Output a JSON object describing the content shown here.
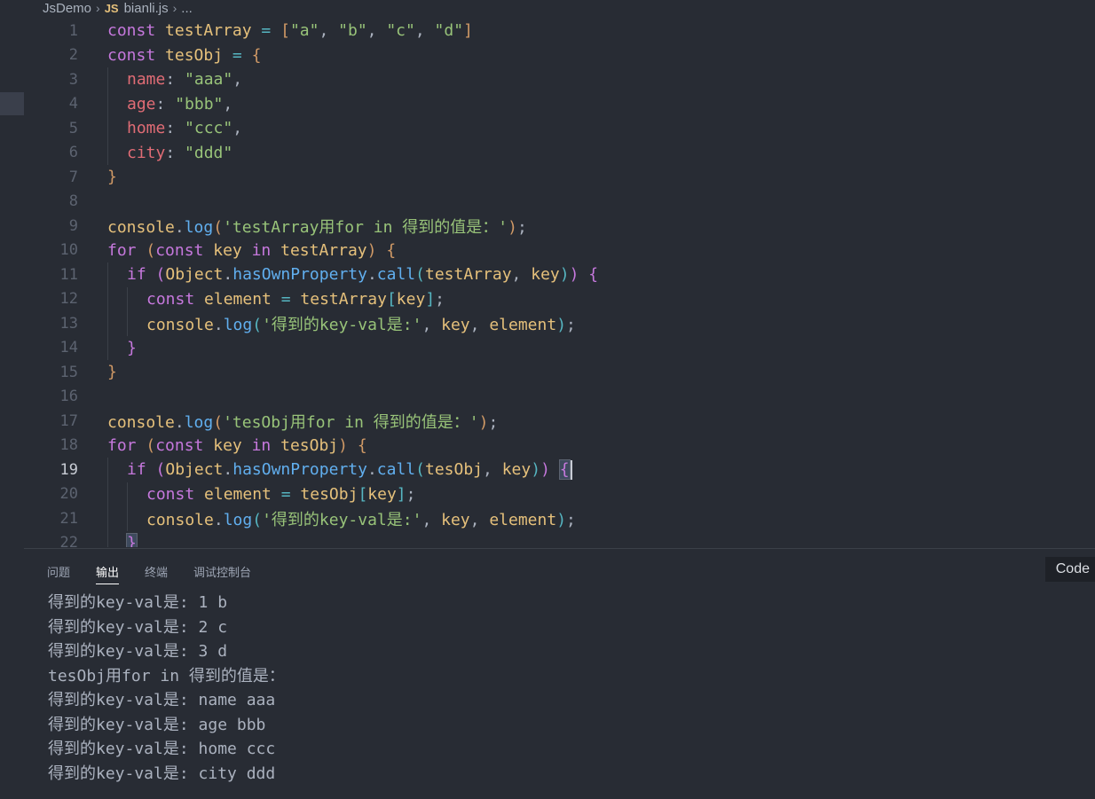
{
  "breadcrumb": {
    "folder": "JsDemo",
    "file_badge": "JS",
    "file": "bianli.js",
    "more": "..."
  },
  "editor": {
    "active_line": 19,
    "lines": [
      {
        "n": "1",
        "indent": 0,
        "tokens": [
          [
            "kw",
            "const "
          ],
          [
            "var",
            "testArray"
          ],
          [
            "op",
            " = "
          ],
          [
            "b1",
            "["
          ],
          [
            "str",
            "\"a\""
          ],
          [
            "pun",
            ", "
          ],
          [
            "str",
            "\"b\""
          ],
          [
            "pun",
            ", "
          ],
          [
            "str",
            "\"c\""
          ],
          [
            "pun",
            ", "
          ],
          [
            "str",
            "\"d\""
          ],
          [
            "b1",
            "]"
          ]
        ]
      },
      {
        "n": "2",
        "indent": 0,
        "tokens": [
          [
            "kw",
            "const "
          ],
          [
            "var",
            "tesObj"
          ],
          [
            "op",
            " = "
          ],
          [
            "b1",
            "{"
          ]
        ]
      },
      {
        "n": "3",
        "indent": 1,
        "tokens": [
          [
            "prop",
            "name"
          ],
          [
            "pun",
            ": "
          ],
          [
            "str",
            "\"aaa\""
          ],
          [
            "pun",
            ","
          ]
        ]
      },
      {
        "n": "4",
        "indent": 1,
        "tokens": [
          [
            "prop",
            "age"
          ],
          [
            "pun",
            ": "
          ],
          [
            "str",
            "\"bbb\""
          ],
          [
            "pun",
            ","
          ]
        ]
      },
      {
        "n": "5",
        "indent": 1,
        "tokens": [
          [
            "prop",
            "home"
          ],
          [
            "pun",
            ": "
          ],
          [
            "str",
            "\"ccc\""
          ],
          [
            "pun",
            ","
          ]
        ]
      },
      {
        "n": "6",
        "indent": 1,
        "tokens": [
          [
            "prop",
            "city"
          ],
          [
            "pun",
            ": "
          ],
          [
            "str",
            "\"ddd\""
          ]
        ]
      },
      {
        "n": "7",
        "indent": 0,
        "tokens": [
          [
            "b1",
            "}"
          ]
        ]
      },
      {
        "n": "8",
        "indent": 0,
        "tokens": []
      },
      {
        "n": "9",
        "indent": 0,
        "tokens": [
          [
            "var",
            "console"
          ],
          [
            "pun",
            "."
          ],
          [
            "fn",
            "log"
          ],
          [
            "b1",
            "("
          ],
          [
            "str",
            "'testArray用for in 得到的值是："
          ],
          [
            "str",
            "'"
          ],
          [
            "b1",
            ")"
          ],
          [
            "pun",
            ";"
          ]
        ]
      },
      {
        "n": "10",
        "indent": 0,
        "tokens": [
          [
            "kw",
            "for "
          ],
          [
            "b1",
            "("
          ],
          [
            "kw",
            "const "
          ],
          [
            "var",
            "key "
          ],
          [
            "kw",
            "in "
          ],
          [
            "var",
            "testArray"
          ],
          [
            "b1",
            ")"
          ],
          [
            "pun",
            " "
          ],
          [
            "b1",
            "{"
          ]
        ]
      },
      {
        "n": "11",
        "indent": 1,
        "tokens": [
          [
            "kw",
            "if "
          ],
          [
            "b2",
            "("
          ],
          [
            "var",
            "Object"
          ],
          [
            "pun",
            "."
          ],
          [
            "fn",
            "hasOwnProperty"
          ],
          [
            "pun",
            "."
          ],
          [
            "fn",
            "call"
          ],
          [
            "b3",
            "("
          ],
          [
            "var",
            "testArray"
          ],
          [
            "pun",
            ", "
          ],
          [
            "var",
            "key"
          ],
          [
            "b3",
            ")"
          ],
          [
            "b2",
            ")"
          ],
          [
            "pun",
            " "
          ],
          [
            "b2",
            "{"
          ]
        ]
      },
      {
        "n": "12",
        "indent": 2,
        "tokens": [
          [
            "kw",
            "const "
          ],
          [
            "var",
            "element"
          ],
          [
            "op",
            " = "
          ],
          [
            "var",
            "testArray"
          ],
          [
            "b3",
            "["
          ],
          [
            "var",
            "key"
          ],
          [
            "b3",
            "]"
          ],
          [
            "pun",
            ";"
          ]
        ]
      },
      {
        "n": "13",
        "indent": 2,
        "tokens": [
          [
            "var",
            "console"
          ],
          [
            "pun",
            "."
          ],
          [
            "fn",
            "log"
          ],
          [
            "b3",
            "("
          ],
          [
            "str",
            "'得到的key-val是:'"
          ],
          [
            "pun",
            ", "
          ],
          [
            "var",
            "key"
          ],
          [
            "pun",
            ", "
          ],
          [
            "var",
            "element"
          ],
          [
            "b3",
            ")"
          ],
          [
            "pun",
            ";"
          ]
        ]
      },
      {
        "n": "14",
        "indent": 1,
        "tokens": [
          [
            "b2",
            "}"
          ]
        ]
      },
      {
        "n": "15",
        "indent": 0,
        "tokens": [
          [
            "b1",
            "}"
          ]
        ]
      },
      {
        "n": "16",
        "indent": 0,
        "tokens": []
      },
      {
        "n": "17",
        "indent": 0,
        "tokens": [
          [
            "var",
            "console"
          ],
          [
            "pun",
            "."
          ],
          [
            "fn",
            "log"
          ],
          [
            "b1",
            "("
          ],
          [
            "str",
            "'tesObj用for in 得到的值是："
          ],
          [
            "str",
            "'"
          ],
          [
            "b1",
            ")"
          ],
          [
            "pun",
            ";"
          ]
        ]
      },
      {
        "n": "18",
        "indent": 0,
        "tokens": [
          [
            "kw",
            "for "
          ],
          [
            "b1",
            "("
          ],
          [
            "kw",
            "const "
          ],
          [
            "var",
            "key "
          ],
          [
            "kw",
            "in "
          ],
          [
            "var",
            "tesObj"
          ],
          [
            "b1",
            ")"
          ],
          [
            "pun",
            " "
          ],
          [
            "b1",
            "{"
          ]
        ]
      },
      {
        "n": "19",
        "indent": 1,
        "tokens": [
          [
            "kw",
            "if "
          ],
          [
            "b2",
            "("
          ],
          [
            "var",
            "Object"
          ],
          [
            "pun",
            "."
          ],
          [
            "fn",
            "hasOwnProperty"
          ],
          [
            "pun",
            "."
          ],
          [
            "fn",
            "call"
          ],
          [
            "b3",
            "("
          ],
          [
            "var",
            "tesObj"
          ],
          [
            "pun",
            ", "
          ],
          [
            "var",
            "key"
          ],
          [
            "b3",
            ")"
          ],
          [
            "b2",
            ")"
          ],
          [
            "pun",
            " "
          ],
          [
            "b2 bm",
            "{"
          ]
        ]
      },
      {
        "n": "20",
        "indent": 2,
        "tokens": [
          [
            "kw",
            "const "
          ],
          [
            "var",
            "element"
          ],
          [
            "op",
            " = "
          ],
          [
            "var",
            "tesObj"
          ],
          [
            "b3",
            "["
          ],
          [
            "var",
            "key"
          ],
          [
            "b3",
            "]"
          ],
          [
            "pun",
            ";"
          ]
        ]
      },
      {
        "n": "21",
        "indent": 2,
        "tokens": [
          [
            "var",
            "console"
          ],
          [
            "pun",
            "."
          ],
          [
            "fn",
            "log"
          ],
          [
            "b3",
            "("
          ],
          [
            "str",
            "'得到的key-val是:'"
          ],
          [
            "pun",
            ", "
          ],
          [
            "var",
            "key"
          ],
          [
            "pun",
            ", "
          ],
          [
            "var",
            "element"
          ],
          [
            "b3",
            ")"
          ],
          [
            "pun",
            ";"
          ]
        ]
      },
      {
        "n": "22",
        "indent": 1,
        "tokens": [
          [
            "b2 bm",
            "}"
          ]
        ]
      }
    ]
  },
  "panel": {
    "tabs": [
      {
        "label": "问题",
        "active": false
      },
      {
        "label": "输出",
        "active": true
      },
      {
        "label": "终端",
        "active": false
      },
      {
        "label": "调试控制台",
        "active": false
      }
    ],
    "output_channel": "Code",
    "output_lines": [
      "得到的key-val是: 1 b",
      "得到的key-val是: 2 c",
      "得到的key-val是: 3 d",
      "tesObj用for in 得到的值是：",
      "得到的key-val是: name aaa",
      "得到的key-val是: age bbb",
      "得到的key-val是: home ccc",
      "得到的key-val是: city ddd"
    ]
  }
}
